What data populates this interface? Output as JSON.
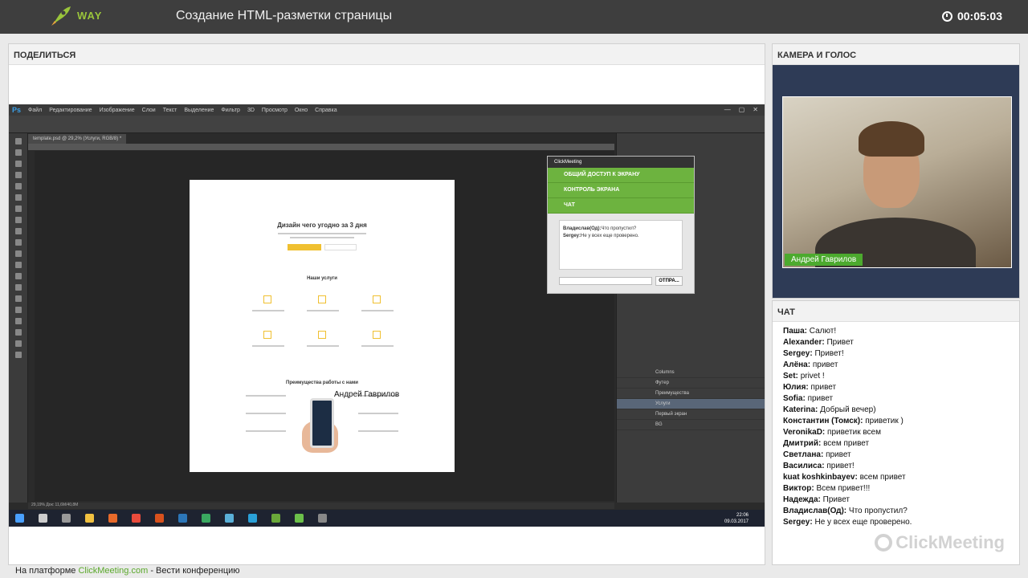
{
  "header": {
    "logo_text": "WAY",
    "title": "Создание HTML-разметки страницы",
    "timer": "00:05:03"
  },
  "share": {
    "title": "ПОДЕЛИТЬСЯ",
    "ps": {
      "logo": "Ps",
      "menu": [
        "Файл",
        "Редактирование",
        "Изображение",
        "Слои",
        "Текст",
        "Выделение",
        "Фильтр",
        "3D",
        "Просмотр",
        "Окно",
        "Справка"
      ],
      "tab": "template.psd @ 29,2% (Услуги, RGB/8) *",
      "doc": {
        "h1": "Дизайн чего угодно за 3 дня",
        "services": "Наши услуги",
        "advantages": "Преимущества работы с нами"
      },
      "layers": [
        "Columns",
        "Футер",
        "Преимущества",
        "Услуги",
        "Первый экран",
        "BG"
      ],
      "cursor_label": "Андрей Гаврилов",
      "status": "29,19%   Док: 11,6M/40,8M",
      "clock_time": "22:06",
      "clock_date": "09.03.2017"
    },
    "popup": {
      "title": "ClickMeeting",
      "bar1": "ОБЩИЙ ДОСТУП К ЭКРАНУ",
      "bar2": "КОНТРОЛЬ ЭКРАНА",
      "bar3": "ЧАТ",
      "msg1_user": "Владислав(Од):",
      "msg1_text": "Что пропустил?",
      "msg2_user": "Sergey:",
      "msg2_text": "Не у всех еще проверено.",
      "send": "ОТПРА..."
    }
  },
  "camera": {
    "title": "КАМЕРА И ГОЛОС",
    "name": "Андрей Гаврилов"
  },
  "chat": {
    "title": "ЧАТ",
    "messages": [
      {
        "user": "Паша:",
        "text": "Салют!"
      },
      {
        "user": "Alexander:",
        "text": "Привет"
      },
      {
        "user": "Sergey:",
        "text": "Привет!"
      },
      {
        "user": "Алёна:",
        "text": "привет"
      },
      {
        "user": "Set:",
        "text": "privet !"
      },
      {
        "user": "Юлия:",
        "text": "привет"
      },
      {
        "user": "Sofia:",
        "text": "привет"
      },
      {
        "user": "Katerina:",
        "text": "Добрый вечер)"
      },
      {
        "user": "Константин (Томск):",
        "text": "приветик )"
      },
      {
        "user": "VeronikaD:",
        "text": "приветик всем"
      },
      {
        "user": "Дмитрий:",
        "text": "всем привет"
      },
      {
        "user": "Светлана:",
        "text": "привет"
      },
      {
        "user": "Василиса:",
        "text": "привет!"
      },
      {
        "user": "kuat koshkinbayev:",
        "text": "всем привет"
      },
      {
        "user": "Виктор:",
        "text": "Всем привет!!!"
      },
      {
        "user": "Надежда:",
        "text": "Привет"
      },
      {
        "user": "Владислав(Од):",
        "text": "Что пропустил?"
      },
      {
        "user": "Sergey:",
        "text": "Не у всех еще проверено."
      }
    ],
    "watermark": "ClickMeeting"
  },
  "footer": {
    "prefix": "На платформе",
    "brand": "ClickMeeting.com",
    "suffix": "- Вести конференцию"
  }
}
